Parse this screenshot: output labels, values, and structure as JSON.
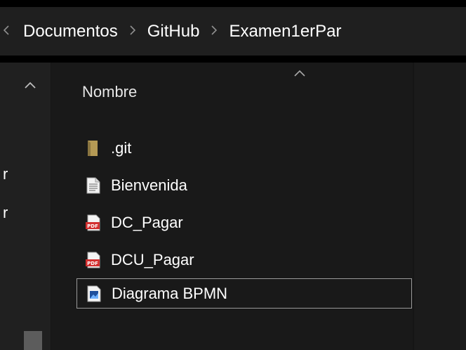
{
  "breadcrumb": {
    "items": [
      "Documentos",
      "GitHub",
      "Examen1erPar"
    ]
  },
  "nav_pane": {
    "partial_labels": [
      "r",
      "r"
    ]
  },
  "file_list": {
    "column_header": "Nombre",
    "sort": "ascending",
    "files": [
      {
        "name": ".git",
        "icon": "folder-icon"
      },
      {
        "name": "Bienvenida",
        "icon": "text-document-icon"
      },
      {
        "name": "DC_Pagar",
        "icon": "pdf-icon"
      },
      {
        "name": "DCU_Pagar",
        "icon": "pdf-icon"
      },
      {
        "name": "Diagrama BPMN",
        "icon": "image-file-icon"
      }
    ],
    "selected_index": 4
  },
  "colors": {
    "background": "#191919",
    "text": "#ffffff",
    "selection_border": "#9a9a9a",
    "pdf_red": "#d32f2f",
    "folder": "#c6a85a"
  }
}
